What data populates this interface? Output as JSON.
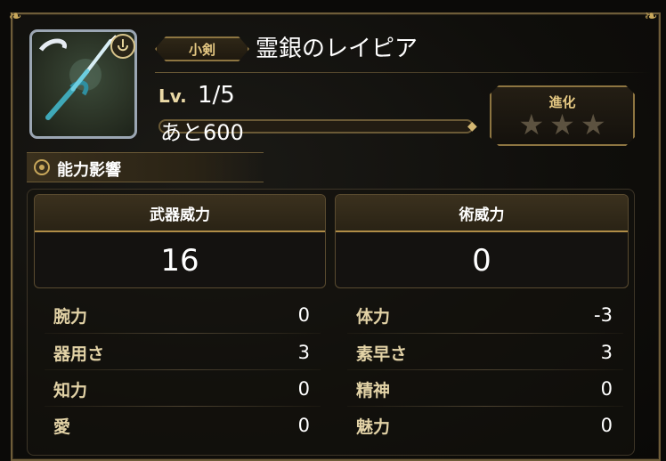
{
  "weapon": {
    "category": "小剣",
    "name": "霊銀のレイピア",
    "level_label": "Lv.",
    "level_value": "1/5",
    "xp_remaining": "あと600",
    "xp_progress": 0
  },
  "evolution": {
    "label": "進化",
    "stars_filled": 0,
    "stars_total": 3
  },
  "ability": {
    "title": "能力影響"
  },
  "power": {
    "weapon_power_label": "武器威力",
    "weapon_power_value": "16",
    "magic_power_label": "術威力",
    "magic_power_value": "0"
  },
  "stats_left": [
    {
      "label": "腕力",
      "value": "0"
    },
    {
      "label": "器用さ",
      "value": "3"
    },
    {
      "label": "知力",
      "value": "0"
    },
    {
      "label": "愛",
      "value": "0"
    }
  ],
  "stats_right": [
    {
      "label": "体力",
      "value": "-3"
    },
    {
      "label": "素早さ",
      "value": "3"
    },
    {
      "label": "精神",
      "value": "0"
    },
    {
      "label": "魅力",
      "value": "0"
    }
  ],
  "colors": {
    "gold": "#c9a85b",
    "frame": "#6e5d39",
    "text": "#ffffff"
  },
  "icons": {
    "weapon": "rapier-icon",
    "lock": "lock-icon",
    "ability": "gear-icon",
    "star": "star-icon"
  }
}
